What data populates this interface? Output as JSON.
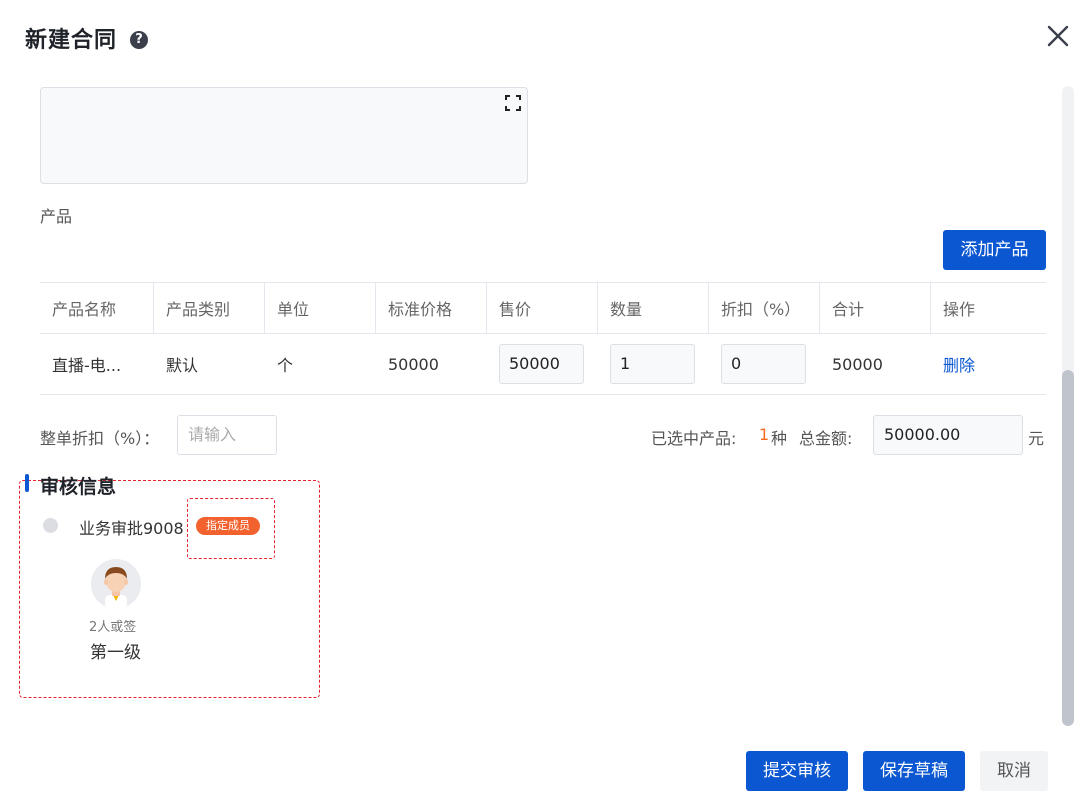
{
  "dialog": {
    "title": "新建合同",
    "help_icon": "question-circle-icon",
    "close_icon": "close-icon"
  },
  "remark": {
    "expand_icon": "fullscreen-icon"
  },
  "products": {
    "label": "产品",
    "add_button": "添加产品",
    "columns": [
      "产品名称",
      "产品类别",
      "单位",
      "标准价格",
      "售价",
      "数量",
      "折扣（%）",
      "合计",
      "操作"
    ],
    "rows": [
      {
        "name": "直播-电...",
        "category": "默认",
        "unit": "个",
        "standard_price": "50000",
        "sale_price": "50000",
        "quantity": "1",
        "discount": "0",
        "total": "50000",
        "action": "删除"
      }
    ]
  },
  "summary": {
    "order_discount_label": "整单折扣（%）：",
    "order_discount_placeholder": "请输入",
    "selected_label": "已选中产品:",
    "selected_count": "1",
    "selected_unit": "种",
    "total_label": "总金额:",
    "total_value": "50000.00",
    "currency": "元"
  },
  "approval": {
    "title": "审核信息",
    "node_name": "业务审批9008",
    "node_badge": "指定成员",
    "sign_mode": "2人或签",
    "level": "第一级",
    "avatar_icon": "user-avatar-icon"
  },
  "footer": {
    "submit": "提交审核",
    "save_draft": "保存草稿",
    "cancel": "取消"
  },
  "colors": {
    "primary": "#0a57d1",
    "badge": "#f2622e",
    "highlight": "#f56c1f",
    "annotation": "#e5232e"
  }
}
